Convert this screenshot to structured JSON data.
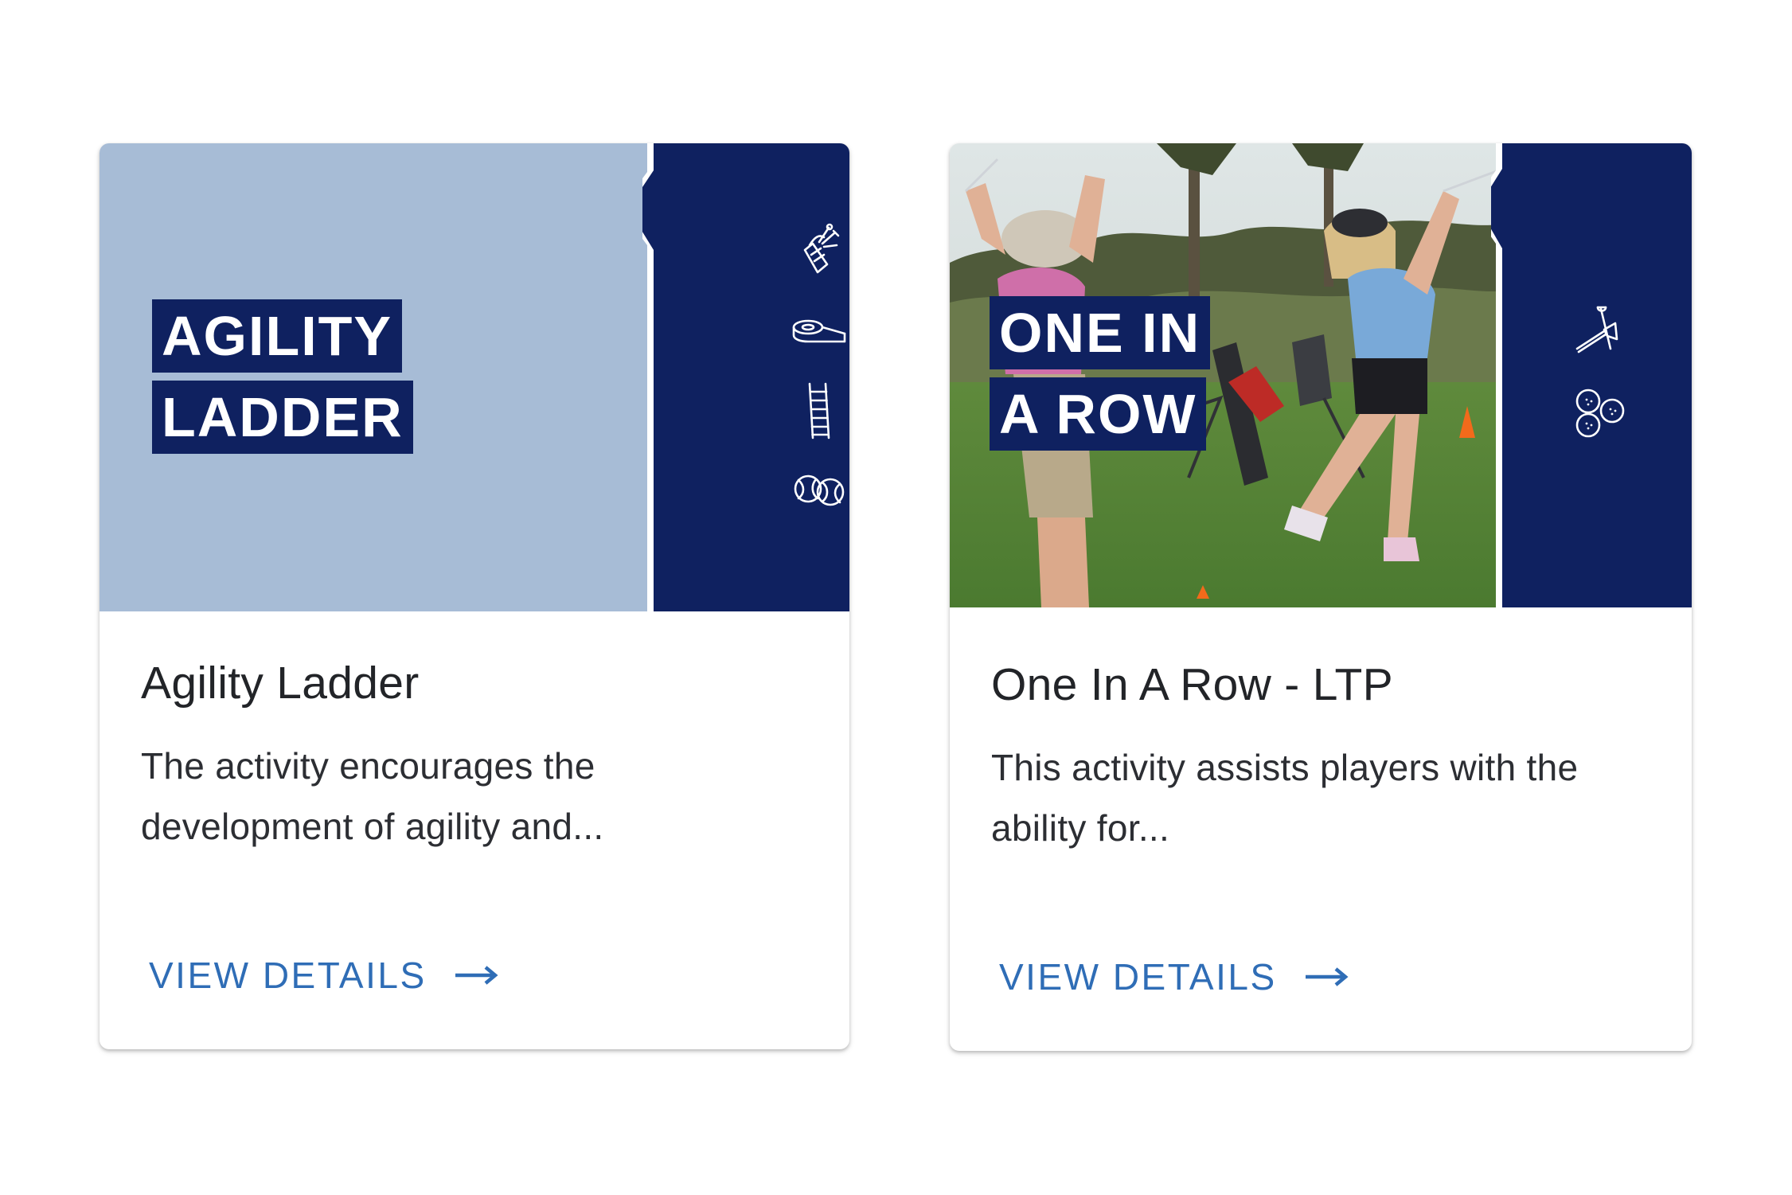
{
  "colors": {
    "navy": "#0f2160",
    "light_blue": "#a7bcd6",
    "link_blue": "#2f6db6",
    "title_text": "#222428",
    "body_text": "#2c2e33"
  },
  "cards": [
    {
      "hero_title_lines": [
        "AGILITY",
        "LADDER"
      ],
      "hero_background": "light-blue",
      "equipment_icons": [
        "golf-bag-icon",
        "tape-icon",
        "ladder-icon",
        "tennis-balls-icon"
      ],
      "title": "Agility Ladder",
      "description": "The activity encourages the development of agility and...",
      "link_label": "VIEW DETAILS",
      "link_icon": "arrow-right-icon"
    },
    {
      "hero_title_lines": [
        "ONE IN",
        "A ROW"
      ],
      "hero_background": "photo",
      "equipment_icons": [
        "golf-tees-icon",
        "golf-balls-icon"
      ],
      "title": "One In A Row - LTP",
      "description": "This activity assists players with the ability for...",
      "link_label": "VIEW DETAILS",
      "link_icon": "arrow-right-icon"
    }
  ]
}
